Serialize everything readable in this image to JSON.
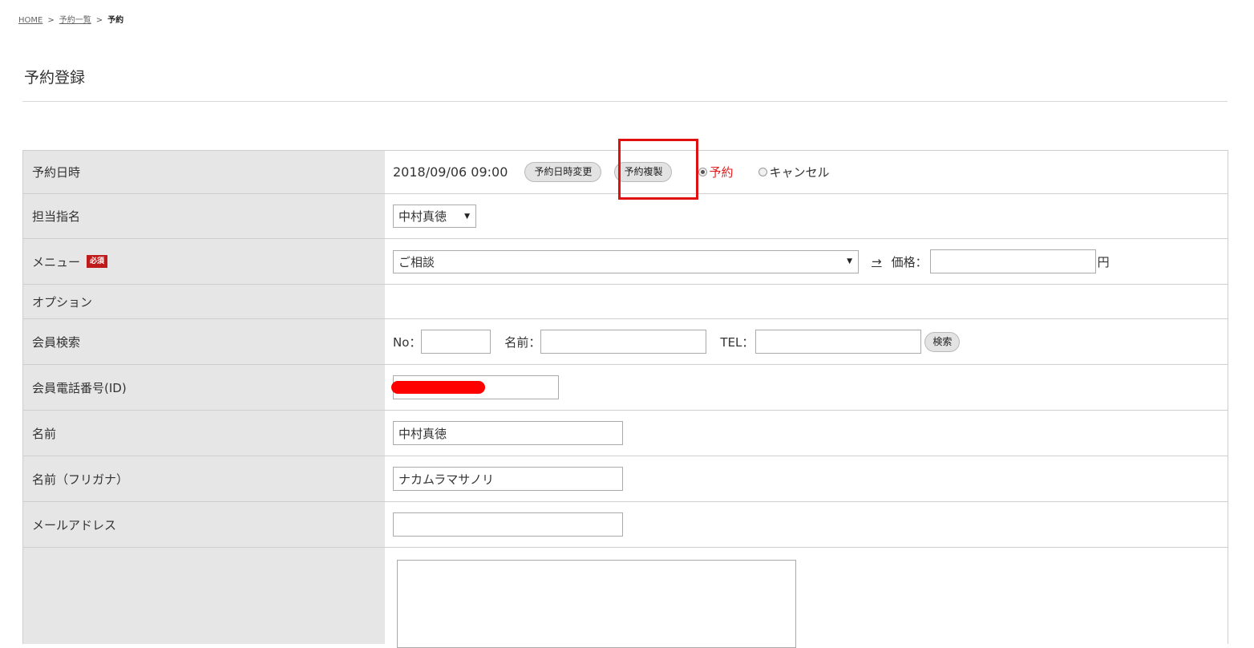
{
  "breadcrumb": {
    "home": "HOME",
    "list": "予約一覧",
    "current": "予約",
    "separator": ">"
  },
  "page": {
    "title": "予約登録"
  },
  "form": {
    "datetime": {
      "label": "予約日時",
      "value": "2018/09/06 09:00",
      "change_button": "予約日時変更",
      "duplicate_button": "予約複製",
      "status_reserve": "予約",
      "status_cancel": "キャンセル"
    },
    "staff": {
      "label": "担当指名",
      "selected": "中村真徳"
    },
    "menu": {
      "label": "メニュー",
      "required_badge": "必須",
      "selected": "ご相談",
      "arrow": "→",
      "price_label": "価格：",
      "price_value": "",
      "price_unit": "円"
    },
    "option": {
      "label": "オプション"
    },
    "member_search": {
      "label": "会員検索",
      "no_label": "No：",
      "name_label": "名前：",
      "tel_label": "TEL：",
      "search_button": "検索"
    },
    "member_phone": {
      "label": "会員電話番号(ID)",
      "value": ""
    },
    "name": {
      "label": "名前",
      "value": "中村真徳"
    },
    "name_kana": {
      "label": "名前（フリガナ）",
      "value": "ナカムラマサノリ"
    },
    "email": {
      "label": "メールアドレス",
      "value": ""
    }
  },
  "colors": {
    "accent_red": "#e31c1c",
    "label_bg": "#e6e6e6",
    "badge_bg": "#c01b1b"
  }
}
